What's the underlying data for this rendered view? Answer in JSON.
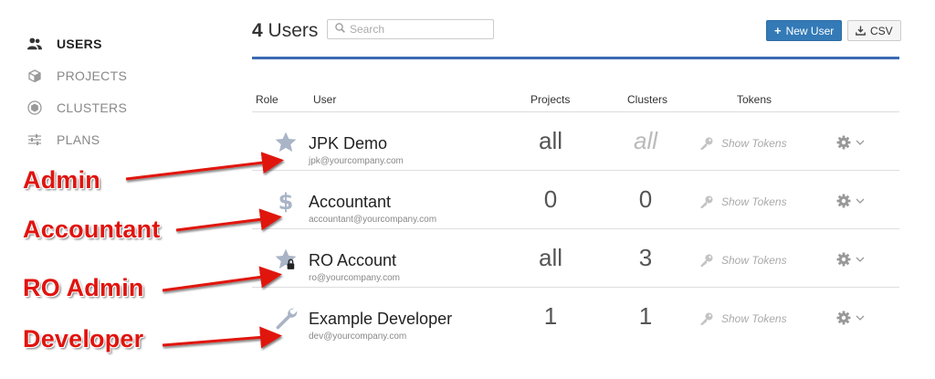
{
  "sidebar": {
    "items": [
      {
        "label": "USERS",
        "icon": "users-icon",
        "active": true
      },
      {
        "label": "PROJECTS",
        "icon": "cube-icon",
        "active": false
      },
      {
        "label": "CLUSTERS",
        "icon": "cluster-icon",
        "active": false
      },
      {
        "label": "PLANS",
        "icon": "sliders-icon",
        "active": false
      }
    ]
  },
  "header": {
    "count": "4",
    "title_suffix": "Users",
    "search_placeholder": "Search",
    "new_user_label": "New User",
    "csv_label": "CSV",
    "accent_color": "#3a6ab3",
    "button_color": "#337ab7"
  },
  "table": {
    "headers": {
      "role": "Role",
      "user": "User",
      "projects": "Projects",
      "clusters": "Clusters",
      "tokens": "Tokens"
    },
    "rows": [
      {
        "role_icon": "star-icon",
        "name": "JPK Demo",
        "email": "jpk@yourcompany.com",
        "projects": "all",
        "clusters": "all",
        "tokens": "Show Tokens"
      },
      {
        "role_icon": "dollar-icon",
        "name": "Accountant",
        "email": "accountant@yourcompany.com",
        "projects": "0",
        "clusters": "0",
        "tokens": "Show Tokens"
      },
      {
        "role_icon": "star-lock-icon",
        "name": "RO Account",
        "email": "ro@yourcompany.com",
        "projects": "all",
        "clusters": "3",
        "tokens": "Show Tokens"
      },
      {
        "role_icon": "wrench-icon",
        "name": "Example Developer",
        "email": "dev@yourcompany.com",
        "projects": "1",
        "clusters": "1",
        "tokens": "Show Tokens"
      }
    ]
  },
  "annotations": {
    "labels": [
      "Admin",
      "Accountant",
      "RO Admin",
      "Developer"
    ],
    "color": "#e0140f"
  }
}
